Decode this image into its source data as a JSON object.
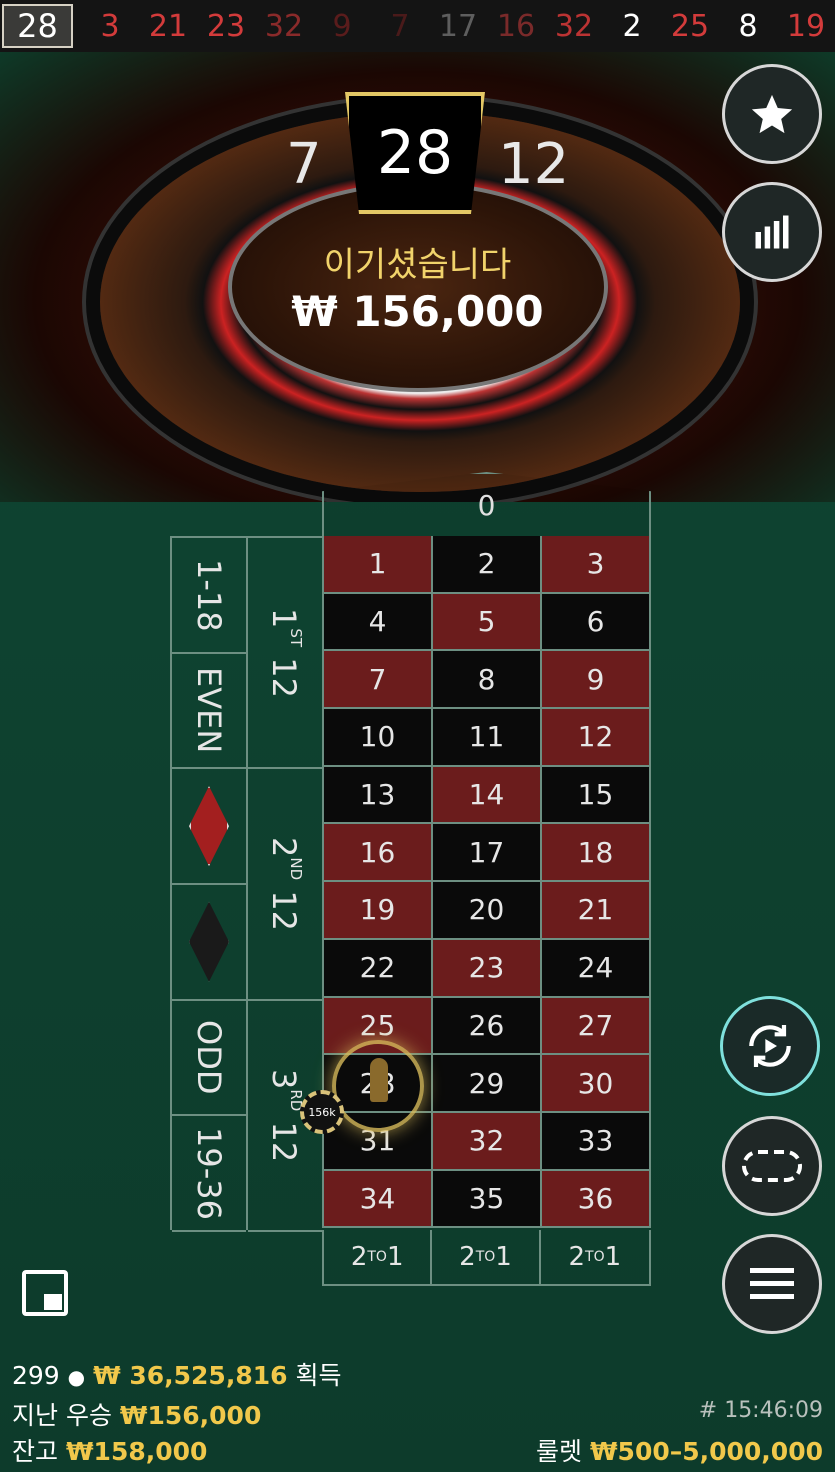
{
  "history": {
    "latest": "28",
    "numbers": [
      {
        "v": "3",
        "c": "#d33b3b"
      },
      {
        "v": "21",
        "c": "#d33b3b"
      },
      {
        "v": "23",
        "c": "#d33b3b"
      },
      {
        "v": "32",
        "c": "#8a2a2a"
      },
      {
        "v": "9",
        "c": "#5a1c1c"
      },
      {
        "v": "7",
        "c": "#4a1a1a"
      },
      {
        "v": "17",
        "c": "#5e5e5e"
      },
      {
        "v": "16",
        "c": "#7a2a2a"
      },
      {
        "v": "32",
        "c": "#b33"
      },
      {
        "v": "2",
        "c": "#ffffff"
      },
      {
        "v": "25",
        "c": "#d33b3b"
      },
      {
        "v": "8",
        "c": "#ffffff"
      },
      {
        "v": "19",
        "c": "#d33b3b"
      }
    ]
  },
  "wheel": {
    "result": "28",
    "left_neighbor": "7",
    "right_neighbor": "12",
    "win_text": "이기셨습니다",
    "win_amount": "₩ 156,000"
  },
  "table": {
    "zero": "0",
    "numbers": [
      {
        "n": "1",
        "c": "red"
      },
      {
        "n": "2",
        "c": "black"
      },
      {
        "n": "3",
        "c": "red"
      },
      {
        "n": "4",
        "c": "black"
      },
      {
        "n": "5",
        "c": "red"
      },
      {
        "n": "6",
        "c": "black"
      },
      {
        "n": "7",
        "c": "red"
      },
      {
        "n": "8",
        "c": "black"
      },
      {
        "n": "9",
        "c": "red"
      },
      {
        "n": "10",
        "c": "black"
      },
      {
        "n": "11",
        "c": "black"
      },
      {
        "n": "12",
        "c": "red"
      },
      {
        "n": "13",
        "c": "black"
      },
      {
        "n": "14",
        "c": "red"
      },
      {
        "n": "15",
        "c": "black"
      },
      {
        "n": "16",
        "c": "red"
      },
      {
        "n": "17",
        "c": "black"
      },
      {
        "n": "18",
        "c": "red"
      },
      {
        "n": "19",
        "c": "red"
      },
      {
        "n": "20",
        "c": "black"
      },
      {
        "n": "21",
        "c": "red"
      },
      {
        "n": "22",
        "c": "black"
      },
      {
        "n": "23",
        "c": "red"
      },
      {
        "n": "24",
        "c": "black"
      },
      {
        "n": "25",
        "c": "red"
      },
      {
        "n": "26",
        "c": "black"
      },
      {
        "n": "27",
        "c": "red"
      },
      {
        "n": "28",
        "c": "black"
      },
      {
        "n": "29",
        "c": "black"
      },
      {
        "n": "30",
        "c": "red"
      },
      {
        "n": "31",
        "c": "black"
      },
      {
        "n": "32",
        "c": "red"
      },
      {
        "n": "33",
        "c": "black"
      },
      {
        "n": "34",
        "c": "red"
      },
      {
        "n": "35",
        "c": "black"
      },
      {
        "n": "36",
        "c": "red"
      }
    ],
    "column_bet": {
      "pre": "2",
      "sup": "TO",
      "post": "1"
    },
    "dozens": [
      {
        "num": "1",
        "sup": "ST",
        "post": "12"
      },
      {
        "num": "2",
        "sup": "ND",
        "post": "12"
      },
      {
        "num": "3",
        "sup": "RD",
        "post": "12"
      }
    ],
    "outside": {
      "low": "1-18",
      "even": "EVEN",
      "red_color": "#a31f1f",
      "black_color": "#1a1a1a",
      "odd": "ODD",
      "high": "19-36"
    },
    "chip_label": "156k"
  },
  "colors": {
    "red": "#6b1c1c",
    "black": "#0a0a0a",
    "gold": "#f1c84b",
    "accent_teal": "#7fe0dc"
  },
  "footer": {
    "players": "299",
    "total_won": "₩ 36,525,816",
    "total_won_suffix": "획득",
    "last_win_label": "지난 우승",
    "last_win": "₩156,000",
    "balance_label": "잔고",
    "balance": "₩158,000",
    "round_id": "# 15:46:09",
    "game_label": "룰렛",
    "limits": "₩500–5,000,000"
  },
  "icons": [
    "star-icon",
    "statistics-icon",
    "repeat-bet-icon",
    "racetrack-icon",
    "menu-icon",
    "pip-icon",
    "user-icon"
  ]
}
